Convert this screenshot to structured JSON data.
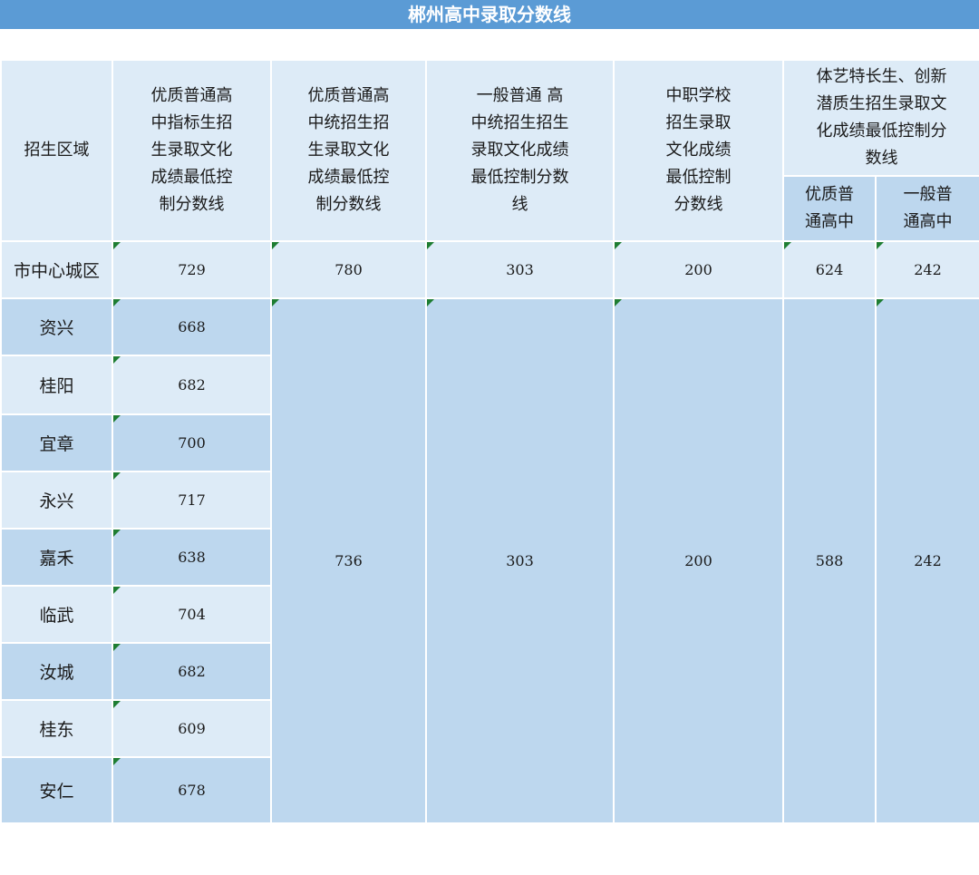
{
  "title": "郴州高中录取分数线",
  "headers": {
    "region": "招生区域",
    "col1": "优质普通高中指标生招生录取文化成绩最低控制分数线",
    "col2": "优质普通高中统招生招生录取文化成绩最低控制分数线",
    "col3": "一般普通 高中统招生招生录取文化成绩最低控制分数线",
    "col4": "中职学校招生录取文化成绩最低控制分数线",
    "col56": "体艺特长生、创新潜质生招生录取文化成绩最低控制分数线",
    "col5": "优质普通高中",
    "col6": "一般普通高中"
  },
  "city": {
    "name": "市中心城区",
    "c1": "729",
    "c2": "780",
    "c3": "303",
    "c4": "200",
    "c5": "624",
    "c6": "242"
  },
  "counties": [
    {
      "name": "资兴",
      "c1": "668"
    },
    {
      "name": "桂阳",
      "c1": "682"
    },
    {
      "name": "宜章",
      "c1": "700"
    },
    {
      "name": "永兴",
      "c1": "717"
    },
    {
      "name": "嘉禾",
      "c1": "638"
    },
    {
      "name": "临武",
      "c1": "704"
    },
    {
      "name": "汝城",
      "c1": "682"
    },
    {
      "name": "桂东",
      "c1": "609"
    },
    {
      "name": "安仁",
      "c1": "678"
    }
  ],
  "county_merged": {
    "c2": "736",
    "c3": "303",
    "c4": "200",
    "c5": "588",
    "c6": "242"
  },
  "colors": {
    "title_bar": "#5b9bd5",
    "light_cell": "#ddebf7",
    "dark_cell": "#bdd7ee",
    "marker": "#1e7d32"
  }
}
